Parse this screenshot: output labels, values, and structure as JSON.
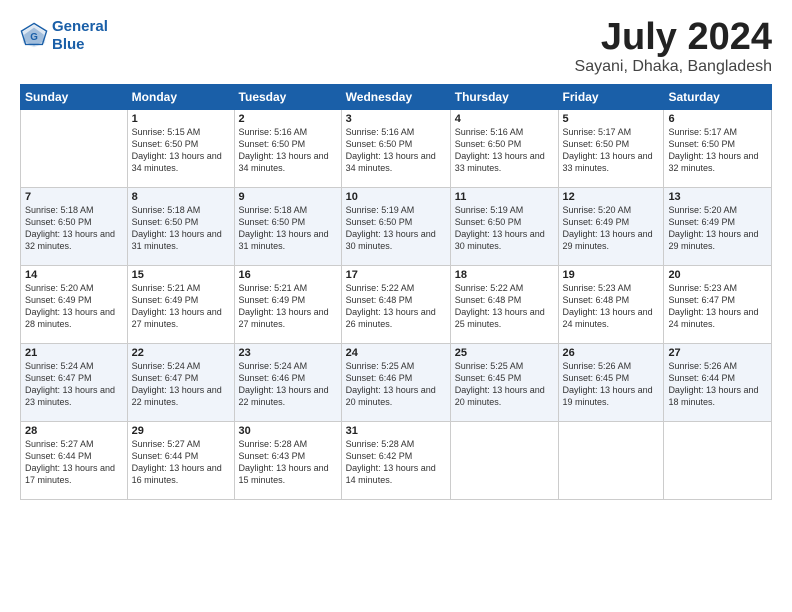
{
  "header": {
    "logo_line1": "General",
    "logo_line2": "Blue",
    "month_title": "July 2024",
    "location": "Sayani, Dhaka, Bangladesh"
  },
  "weekdays": [
    "Sunday",
    "Monday",
    "Tuesday",
    "Wednesday",
    "Thursday",
    "Friday",
    "Saturday"
  ],
  "weeks": [
    [
      {
        "day": "",
        "sunrise": "",
        "sunset": "",
        "daylight": ""
      },
      {
        "day": "1",
        "sunrise": "Sunrise: 5:15 AM",
        "sunset": "Sunset: 6:50 PM",
        "daylight": "Daylight: 13 hours and 34 minutes."
      },
      {
        "day": "2",
        "sunrise": "Sunrise: 5:16 AM",
        "sunset": "Sunset: 6:50 PM",
        "daylight": "Daylight: 13 hours and 34 minutes."
      },
      {
        "day": "3",
        "sunrise": "Sunrise: 5:16 AM",
        "sunset": "Sunset: 6:50 PM",
        "daylight": "Daylight: 13 hours and 34 minutes."
      },
      {
        "day": "4",
        "sunrise": "Sunrise: 5:16 AM",
        "sunset": "Sunset: 6:50 PM",
        "daylight": "Daylight: 13 hours and 33 minutes."
      },
      {
        "day": "5",
        "sunrise": "Sunrise: 5:17 AM",
        "sunset": "Sunset: 6:50 PM",
        "daylight": "Daylight: 13 hours and 33 minutes."
      },
      {
        "day": "6",
        "sunrise": "Sunrise: 5:17 AM",
        "sunset": "Sunset: 6:50 PM",
        "daylight": "Daylight: 13 hours and 32 minutes."
      }
    ],
    [
      {
        "day": "7",
        "sunrise": "Sunrise: 5:18 AM",
        "sunset": "Sunset: 6:50 PM",
        "daylight": "Daylight: 13 hours and 32 minutes."
      },
      {
        "day": "8",
        "sunrise": "Sunrise: 5:18 AM",
        "sunset": "Sunset: 6:50 PM",
        "daylight": "Daylight: 13 hours and 31 minutes."
      },
      {
        "day": "9",
        "sunrise": "Sunrise: 5:18 AM",
        "sunset": "Sunset: 6:50 PM",
        "daylight": "Daylight: 13 hours and 31 minutes."
      },
      {
        "day": "10",
        "sunrise": "Sunrise: 5:19 AM",
        "sunset": "Sunset: 6:50 PM",
        "daylight": "Daylight: 13 hours and 30 minutes."
      },
      {
        "day": "11",
        "sunrise": "Sunrise: 5:19 AM",
        "sunset": "Sunset: 6:50 PM",
        "daylight": "Daylight: 13 hours and 30 minutes."
      },
      {
        "day": "12",
        "sunrise": "Sunrise: 5:20 AM",
        "sunset": "Sunset: 6:49 PM",
        "daylight": "Daylight: 13 hours and 29 minutes."
      },
      {
        "day": "13",
        "sunrise": "Sunrise: 5:20 AM",
        "sunset": "Sunset: 6:49 PM",
        "daylight": "Daylight: 13 hours and 29 minutes."
      }
    ],
    [
      {
        "day": "14",
        "sunrise": "Sunrise: 5:20 AM",
        "sunset": "Sunset: 6:49 PM",
        "daylight": "Daylight: 13 hours and 28 minutes."
      },
      {
        "day": "15",
        "sunrise": "Sunrise: 5:21 AM",
        "sunset": "Sunset: 6:49 PM",
        "daylight": "Daylight: 13 hours and 27 minutes."
      },
      {
        "day": "16",
        "sunrise": "Sunrise: 5:21 AM",
        "sunset": "Sunset: 6:49 PM",
        "daylight": "Daylight: 13 hours and 27 minutes."
      },
      {
        "day": "17",
        "sunrise": "Sunrise: 5:22 AM",
        "sunset": "Sunset: 6:48 PM",
        "daylight": "Daylight: 13 hours and 26 minutes."
      },
      {
        "day": "18",
        "sunrise": "Sunrise: 5:22 AM",
        "sunset": "Sunset: 6:48 PM",
        "daylight": "Daylight: 13 hours and 25 minutes."
      },
      {
        "day": "19",
        "sunrise": "Sunrise: 5:23 AM",
        "sunset": "Sunset: 6:48 PM",
        "daylight": "Daylight: 13 hours and 24 minutes."
      },
      {
        "day": "20",
        "sunrise": "Sunrise: 5:23 AM",
        "sunset": "Sunset: 6:47 PM",
        "daylight": "Daylight: 13 hours and 24 minutes."
      }
    ],
    [
      {
        "day": "21",
        "sunrise": "Sunrise: 5:24 AM",
        "sunset": "Sunset: 6:47 PM",
        "daylight": "Daylight: 13 hours and 23 minutes."
      },
      {
        "day": "22",
        "sunrise": "Sunrise: 5:24 AM",
        "sunset": "Sunset: 6:47 PM",
        "daylight": "Daylight: 13 hours and 22 minutes."
      },
      {
        "day": "23",
        "sunrise": "Sunrise: 5:24 AM",
        "sunset": "Sunset: 6:46 PM",
        "daylight": "Daylight: 13 hours and 22 minutes."
      },
      {
        "day": "24",
        "sunrise": "Sunrise: 5:25 AM",
        "sunset": "Sunset: 6:46 PM",
        "daylight": "Daylight: 13 hours and 20 minutes."
      },
      {
        "day": "25",
        "sunrise": "Sunrise: 5:25 AM",
        "sunset": "Sunset: 6:45 PM",
        "daylight": "Daylight: 13 hours and 20 minutes."
      },
      {
        "day": "26",
        "sunrise": "Sunrise: 5:26 AM",
        "sunset": "Sunset: 6:45 PM",
        "daylight": "Daylight: 13 hours and 19 minutes."
      },
      {
        "day": "27",
        "sunrise": "Sunrise: 5:26 AM",
        "sunset": "Sunset: 6:44 PM",
        "daylight": "Daylight: 13 hours and 18 minutes."
      }
    ],
    [
      {
        "day": "28",
        "sunrise": "Sunrise: 5:27 AM",
        "sunset": "Sunset: 6:44 PM",
        "daylight": "Daylight: 13 hours and 17 minutes."
      },
      {
        "day": "29",
        "sunrise": "Sunrise: 5:27 AM",
        "sunset": "Sunset: 6:44 PM",
        "daylight": "Daylight: 13 hours and 16 minutes."
      },
      {
        "day": "30",
        "sunrise": "Sunrise: 5:28 AM",
        "sunset": "Sunset: 6:43 PM",
        "daylight": "Daylight: 13 hours and 15 minutes."
      },
      {
        "day": "31",
        "sunrise": "Sunrise: 5:28 AM",
        "sunset": "Sunset: 6:42 PM",
        "daylight": "Daylight: 13 hours and 14 minutes."
      },
      {
        "day": "",
        "sunrise": "",
        "sunset": "",
        "daylight": ""
      },
      {
        "day": "",
        "sunrise": "",
        "sunset": "",
        "daylight": ""
      },
      {
        "day": "",
        "sunrise": "",
        "sunset": "",
        "daylight": ""
      }
    ]
  ]
}
